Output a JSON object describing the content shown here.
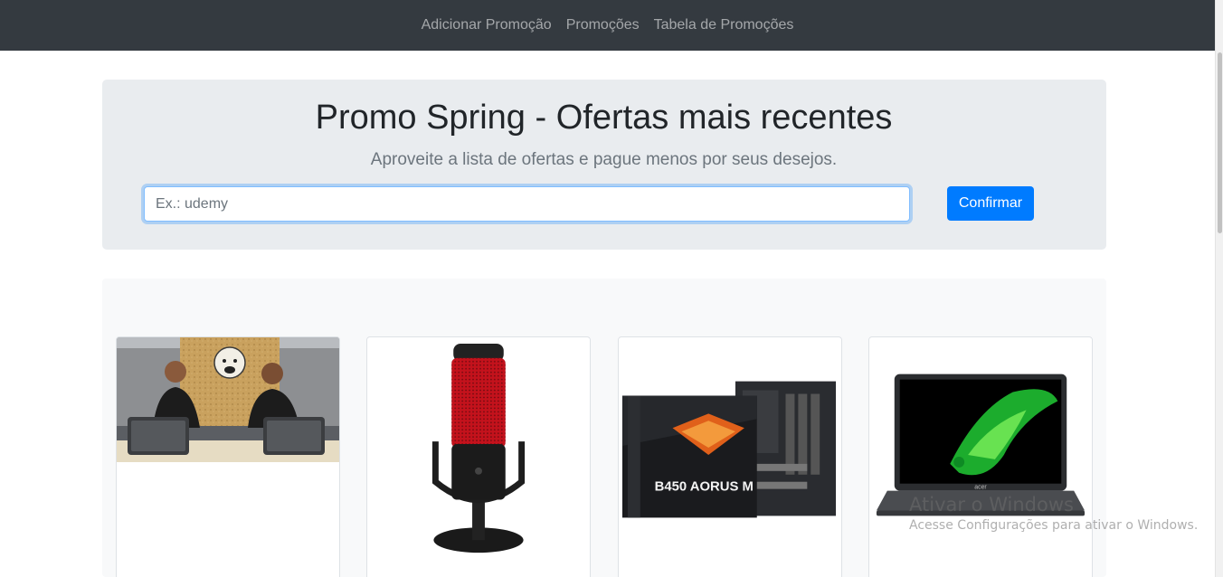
{
  "navbar": {
    "links": [
      "Adicionar Promoção",
      "Promoções",
      "Tabela de Promoções"
    ]
  },
  "jumbotron": {
    "title": "Promo Spring - Ofertas mais recentes",
    "subtitle": "Aproveite a lista de ofertas e pague menos por seus desejos.",
    "search_placeholder": "Ex.: udemy",
    "search_value": "",
    "confirm_label": "Confirmar"
  },
  "cards": [
    {
      "image": "udemy-course-photo"
    },
    {
      "image": "hyperx-quadcast-microphone"
    },
    {
      "image": "b450-aorus-m-motherboard"
    },
    {
      "image": "acer-laptop"
    }
  ],
  "product_text": {
    "motherboard_box": "B450 AORUS M",
    "laptop_logo": "acer"
  },
  "windows_watermark": {
    "title": "Ativar o Windows",
    "subtitle": "Acesse Configurações para ativar o Windows."
  },
  "colors": {
    "navbar_bg": "#343a40",
    "primary": "#007bff",
    "jumbotron_bg": "#e9ecef"
  }
}
